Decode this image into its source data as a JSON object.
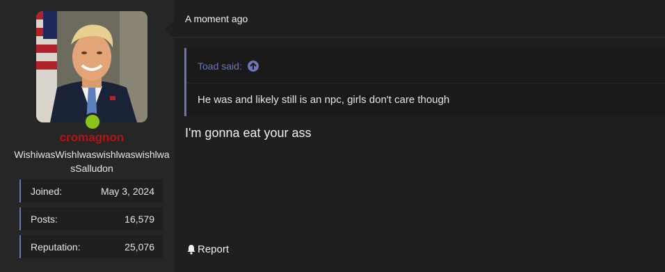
{
  "user": {
    "name": "cromagnon",
    "title": "WishiwasWishlwaswishlwaswishlwasSalludon",
    "stats": [
      {
        "label": "Joined:",
        "value": "May 3, 2024"
      },
      {
        "label": "Posts:",
        "value": "16,579"
      },
      {
        "label": "Reputation:",
        "value": "25,076"
      }
    ]
  },
  "post": {
    "timestamp": "A moment ago",
    "quote": {
      "author_line": "Toad said:",
      "text": "He was and likely still is an npc, girls don't care though"
    },
    "message": "I'm gonna eat your ass",
    "report_label": "Report"
  },
  "colors": {
    "accent": "#6a76b8",
    "username": "#b31515",
    "online": "#8ac41b"
  },
  "icons": {
    "quote_jump": "arrow-up-circle-icon",
    "report": "bell-icon"
  }
}
